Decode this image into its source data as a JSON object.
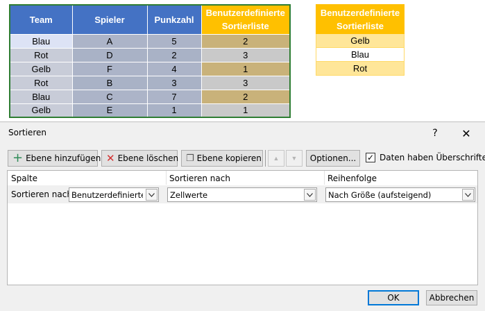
{
  "sheet": {
    "headers": [
      "Team",
      "Spieler",
      "Punkzahl",
      "Benutzerdefinierte Sortierliste"
    ],
    "rows": [
      [
        "Blau",
        "A",
        "5",
        "2"
      ],
      [
        "Rot",
        "D",
        "2",
        "3"
      ],
      [
        "Gelb",
        "F",
        "4",
        "1"
      ],
      [
        "Rot",
        "B",
        "3",
        "3"
      ],
      [
        "Blau",
        "C",
        "7",
        "2"
      ],
      [
        "Gelb",
        "E",
        "1",
        "1"
      ]
    ],
    "list_header": "Benutzerdefinierte Sortierliste",
    "list_items": [
      "Gelb",
      "Blau",
      "Rot"
    ],
    "colors": {
      "header_blue": "#4472c4",
      "header_gold": "#ffc000",
      "list_fill": "#ffe699",
      "selection_border": "#2e7d32"
    }
  },
  "dialog": {
    "title": "Sortieren",
    "help": "?",
    "close": "✕",
    "toolbar": {
      "add_level": "Ebene hinzufügen",
      "delete_level": "Ebene löschen",
      "copy_level": "Ebene kopieren",
      "options": "Optionen...",
      "move_up_icon": "triangle-up",
      "move_down_icon": "triangle-down"
    },
    "headers_checkbox": {
      "label": "Daten haben Überschriften",
      "checked": true,
      "mark": "✓"
    },
    "columns": {
      "column": "Spalte",
      "sort_on": "Sortieren nach",
      "order": "Reihenfolge"
    },
    "level": {
      "label": "Sortieren nach",
      "column_value": "Benutzerdefinierte Sortierliste",
      "sort_on_value": "Zellwerte",
      "order_value": "Nach Größe (aufsteigend)"
    },
    "ok": "OK",
    "cancel": "Abbrechen"
  }
}
